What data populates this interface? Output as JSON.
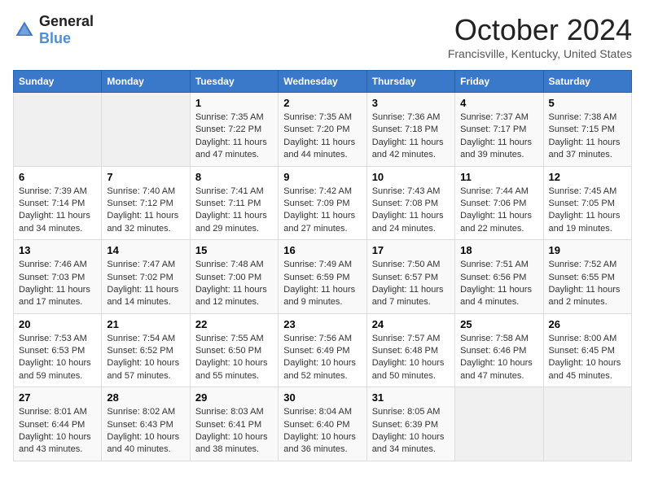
{
  "logo": {
    "general": "General",
    "blue": "Blue"
  },
  "header": {
    "month": "October 2024",
    "location": "Francisville, Kentucky, United States"
  },
  "days_of_week": [
    "Sunday",
    "Monday",
    "Tuesday",
    "Wednesday",
    "Thursday",
    "Friday",
    "Saturday"
  ],
  "weeks": [
    [
      {
        "day": "",
        "sunrise": "",
        "sunset": "",
        "daylight": ""
      },
      {
        "day": "",
        "sunrise": "",
        "sunset": "",
        "daylight": ""
      },
      {
        "day": "1",
        "sunrise": "Sunrise: 7:35 AM",
        "sunset": "Sunset: 7:22 PM",
        "daylight": "Daylight: 11 hours and 47 minutes."
      },
      {
        "day": "2",
        "sunrise": "Sunrise: 7:35 AM",
        "sunset": "Sunset: 7:20 PM",
        "daylight": "Daylight: 11 hours and 44 minutes."
      },
      {
        "day": "3",
        "sunrise": "Sunrise: 7:36 AM",
        "sunset": "Sunset: 7:18 PM",
        "daylight": "Daylight: 11 hours and 42 minutes."
      },
      {
        "day": "4",
        "sunrise": "Sunrise: 7:37 AM",
        "sunset": "Sunset: 7:17 PM",
        "daylight": "Daylight: 11 hours and 39 minutes."
      },
      {
        "day": "5",
        "sunrise": "Sunrise: 7:38 AM",
        "sunset": "Sunset: 7:15 PM",
        "daylight": "Daylight: 11 hours and 37 minutes."
      }
    ],
    [
      {
        "day": "6",
        "sunrise": "Sunrise: 7:39 AM",
        "sunset": "Sunset: 7:14 PM",
        "daylight": "Daylight: 11 hours and 34 minutes."
      },
      {
        "day": "7",
        "sunrise": "Sunrise: 7:40 AM",
        "sunset": "Sunset: 7:12 PM",
        "daylight": "Daylight: 11 hours and 32 minutes."
      },
      {
        "day": "8",
        "sunrise": "Sunrise: 7:41 AM",
        "sunset": "Sunset: 7:11 PM",
        "daylight": "Daylight: 11 hours and 29 minutes."
      },
      {
        "day": "9",
        "sunrise": "Sunrise: 7:42 AM",
        "sunset": "Sunset: 7:09 PM",
        "daylight": "Daylight: 11 hours and 27 minutes."
      },
      {
        "day": "10",
        "sunrise": "Sunrise: 7:43 AM",
        "sunset": "Sunset: 7:08 PM",
        "daylight": "Daylight: 11 hours and 24 minutes."
      },
      {
        "day": "11",
        "sunrise": "Sunrise: 7:44 AM",
        "sunset": "Sunset: 7:06 PM",
        "daylight": "Daylight: 11 hours and 22 minutes."
      },
      {
        "day": "12",
        "sunrise": "Sunrise: 7:45 AM",
        "sunset": "Sunset: 7:05 PM",
        "daylight": "Daylight: 11 hours and 19 minutes."
      }
    ],
    [
      {
        "day": "13",
        "sunrise": "Sunrise: 7:46 AM",
        "sunset": "Sunset: 7:03 PM",
        "daylight": "Daylight: 11 hours and 17 minutes."
      },
      {
        "day": "14",
        "sunrise": "Sunrise: 7:47 AM",
        "sunset": "Sunset: 7:02 PM",
        "daylight": "Daylight: 11 hours and 14 minutes."
      },
      {
        "day": "15",
        "sunrise": "Sunrise: 7:48 AM",
        "sunset": "Sunset: 7:00 PM",
        "daylight": "Daylight: 11 hours and 12 minutes."
      },
      {
        "day": "16",
        "sunrise": "Sunrise: 7:49 AM",
        "sunset": "Sunset: 6:59 PM",
        "daylight": "Daylight: 11 hours and 9 minutes."
      },
      {
        "day": "17",
        "sunrise": "Sunrise: 7:50 AM",
        "sunset": "Sunset: 6:57 PM",
        "daylight": "Daylight: 11 hours and 7 minutes."
      },
      {
        "day": "18",
        "sunrise": "Sunrise: 7:51 AM",
        "sunset": "Sunset: 6:56 PM",
        "daylight": "Daylight: 11 hours and 4 minutes."
      },
      {
        "day": "19",
        "sunrise": "Sunrise: 7:52 AM",
        "sunset": "Sunset: 6:55 PM",
        "daylight": "Daylight: 11 hours and 2 minutes."
      }
    ],
    [
      {
        "day": "20",
        "sunrise": "Sunrise: 7:53 AM",
        "sunset": "Sunset: 6:53 PM",
        "daylight": "Daylight: 10 hours and 59 minutes."
      },
      {
        "day": "21",
        "sunrise": "Sunrise: 7:54 AM",
        "sunset": "Sunset: 6:52 PM",
        "daylight": "Daylight: 10 hours and 57 minutes."
      },
      {
        "day": "22",
        "sunrise": "Sunrise: 7:55 AM",
        "sunset": "Sunset: 6:50 PM",
        "daylight": "Daylight: 10 hours and 55 minutes."
      },
      {
        "day": "23",
        "sunrise": "Sunrise: 7:56 AM",
        "sunset": "Sunset: 6:49 PM",
        "daylight": "Daylight: 10 hours and 52 minutes."
      },
      {
        "day": "24",
        "sunrise": "Sunrise: 7:57 AM",
        "sunset": "Sunset: 6:48 PM",
        "daylight": "Daylight: 10 hours and 50 minutes."
      },
      {
        "day": "25",
        "sunrise": "Sunrise: 7:58 AM",
        "sunset": "Sunset: 6:46 PM",
        "daylight": "Daylight: 10 hours and 47 minutes."
      },
      {
        "day": "26",
        "sunrise": "Sunrise: 8:00 AM",
        "sunset": "Sunset: 6:45 PM",
        "daylight": "Daylight: 10 hours and 45 minutes."
      }
    ],
    [
      {
        "day": "27",
        "sunrise": "Sunrise: 8:01 AM",
        "sunset": "Sunset: 6:44 PM",
        "daylight": "Daylight: 10 hours and 43 minutes."
      },
      {
        "day": "28",
        "sunrise": "Sunrise: 8:02 AM",
        "sunset": "Sunset: 6:43 PM",
        "daylight": "Daylight: 10 hours and 40 minutes."
      },
      {
        "day": "29",
        "sunrise": "Sunrise: 8:03 AM",
        "sunset": "Sunset: 6:41 PM",
        "daylight": "Daylight: 10 hours and 38 minutes."
      },
      {
        "day": "30",
        "sunrise": "Sunrise: 8:04 AM",
        "sunset": "Sunset: 6:40 PM",
        "daylight": "Daylight: 10 hours and 36 minutes."
      },
      {
        "day": "31",
        "sunrise": "Sunrise: 8:05 AM",
        "sunset": "Sunset: 6:39 PM",
        "daylight": "Daylight: 10 hours and 34 minutes."
      },
      {
        "day": "",
        "sunrise": "",
        "sunset": "",
        "daylight": ""
      },
      {
        "day": "",
        "sunrise": "",
        "sunset": "",
        "daylight": ""
      }
    ]
  ]
}
